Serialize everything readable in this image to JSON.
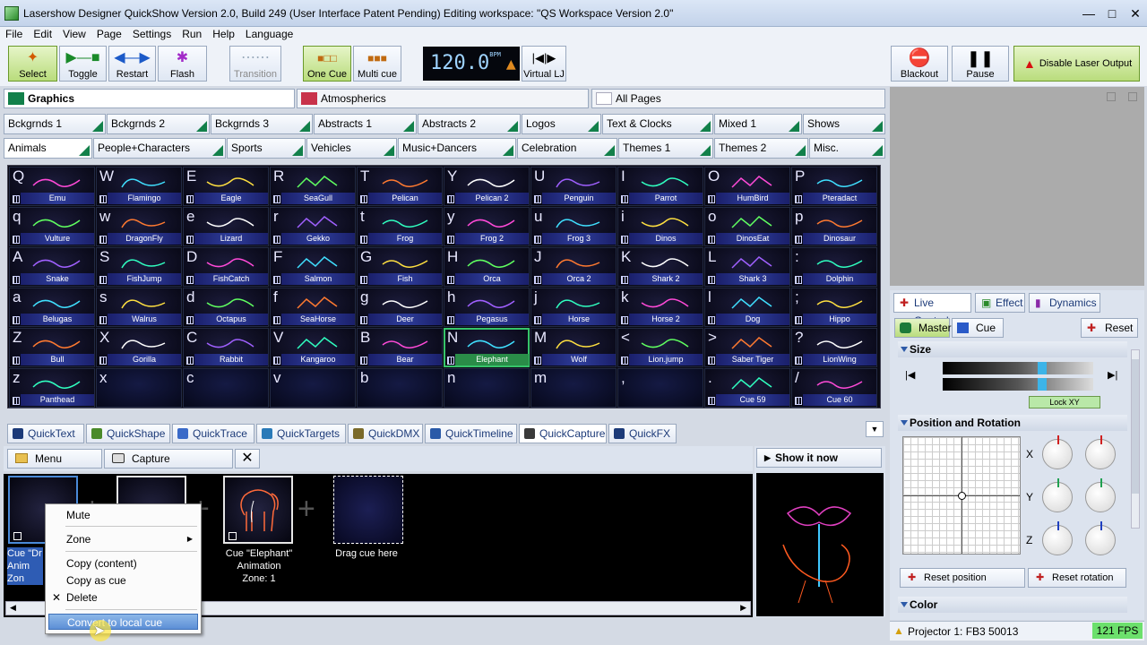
{
  "title": "Lasershow Designer QuickShow   Version 2.0, Build 249   (User Interface Patent Pending)   Editing workspace: \"QS Workspace Version 2.0\"",
  "menu": [
    "File",
    "Edit",
    "View",
    "Page",
    "Settings",
    "Run",
    "Help",
    "Language"
  ],
  "toolbar": {
    "select": "Select",
    "toggle": "Toggle",
    "restart": "Restart",
    "flash": "Flash",
    "transition": "Transition",
    "one_cue": "One Cue",
    "multi_cue": "Multi cue",
    "bpm": "120.0",
    "bpm_unit": "BPM",
    "virtual_lj": "Virtual LJ",
    "blackout": "Blackout",
    "pause": "Pause",
    "disable_laser": "Disable Laser Output"
  },
  "categories": {
    "graphics": "Graphics",
    "atmospherics": "Atmospherics",
    "all_pages": "All Pages"
  },
  "tabs_row1": [
    "Bckgrnds 1",
    "Bckgrnds 2",
    "Bckgrnds 3",
    "Abstracts 1",
    "Abstracts 2",
    "Logos",
    "Text & Clocks",
    "Mixed 1",
    "Shows"
  ],
  "tabs_row2": [
    "Animals",
    "People+Characters",
    "Sports",
    "Vehicles",
    "Music+Dancers",
    "Celebration",
    "Themes 1",
    "Themes 2",
    "Misc."
  ],
  "grid": [
    [
      [
        "Q",
        "Emu"
      ],
      [
        "W",
        "Flamingo"
      ],
      [
        "E",
        "Eagle"
      ],
      [
        "R",
        "SeaGull"
      ],
      [
        "T",
        "Pelican"
      ],
      [
        "Y",
        "Pelican 2"
      ],
      [
        "U",
        "Penguin"
      ],
      [
        "I",
        "Parrot"
      ],
      [
        "O",
        "HumBird"
      ],
      [
        "P",
        "Pteradact"
      ]
    ],
    [
      [
        "q",
        "Vulture"
      ],
      [
        "w",
        "DragonFly"
      ],
      [
        "e",
        "Lizard"
      ],
      [
        "r",
        "Gekko"
      ],
      [
        "t",
        "Frog"
      ],
      [
        "y",
        "Frog 2"
      ],
      [
        "u",
        "Frog 3"
      ],
      [
        "i",
        "Dinos"
      ],
      [
        "o",
        "DinosEat"
      ],
      [
        "p",
        "Dinosaur"
      ]
    ],
    [
      [
        "A",
        "Snake"
      ],
      [
        "S",
        "FishJump"
      ],
      [
        "D",
        "FishCatch"
      ],
      [
        "F",
        "Salmon"
      ],
      [
        "G",
        "Fish"
      ],
      [
        "H",
        "Orca"
      ],
      [
        "J",
        "Orca 2"
      ],
      [
        "K",
        "Shark 2"
      ],
      [
        "L",
        "Shark 3"
      ],
      [
        ":",
        "Dolphin"
      ]
    ],
    [
      [
        "a",
        "Belugas"
      ],
      [
        "s",
        "Walrus"
      ],
      [
        "d",
        "Octapus"
      ],
      [
        "f",
        "SeaHorse"
      ],
      [
        "g",
        "Deer"
      ],
      [
        "h",
        "Pegasus"
      ],
      [
        "j",
        "Horse"
      ],
      [
        "k",
        "Horse 2"
      ],
      [
        "l",
        "Dog"
      ],
      [
        ";",
        "Hippo"
      ]
    ],
    [
      [
        "Z",
        "Bull"
      ],
      [
        "X",
        "Gorilla"
      ],
      [
        "C",
        "Rabbit"
      ],
      [
        "V",
        "Kangaroo"
      ],
      [
        "B",
        "Bear"
      ],
      [
        "N",
        "Elephant"
      ],
      [
        "M",
        "Wolf"
      ],
      [
        "<",
        "Lion.jump"
      ],
      [
        ">",
        "Saber Tiger"
      ],
      [
        "?",
        "LionWing"
      ]
    ],
    [
      [
        "z",
        "Panthead"
      ],
      [
        "x",
        ""
      ],
      [
        "c",
        ""
      ],
      [
        "v",
        ""
      ],
      [
        "b",
        ""
      ],
      [
        "n",
        ""
      ],
      [
        "m",
        ""
      ],
      [
        ",",
        ""
      ],
      [
        ".",
        "Cue 59"
      ],
      [
        "/",
        "Cue 60"
      ]
    ]
  ],
  "bottom_tabs": [
    "QuickText",
    "QuickShape",
    "QuickTrace",
    "QuickTargets",
    "QuickDMX",
    "QuickTimeline",
    "QuickCapture",
    "QuickFX"
  ],
  "capture": {
    "menu": "Menu",
    "capture": "Capture",
    "show_it_now": "Show it now",
    "drag_here": "Drag cue here",
    "cue1": [
      "Cue \"Dr",
      "Anim",
      "Zon"
    ],
    "cue3": [
      "Cue \"Elephant\"",
      "Animation",
      "Zone: 1"
    ]
  },
  "context_menu": [
    "Mute",
    "Zone",
    "Copy (content)",
    "Copy as cue",
    "Delete",
    "Convert to local cue"
  ],
  "live": {
    "tab_live": "Live Control",
    "tab_effect": "Effect",
    "tab_dynamics": "Dynamics",
    "master": "Master",
    "cue": "Cue",
    "reset": "Reset",
    "size": "Size",
    "lock_xy": "Lock XY",
    "pos_rot": "Position and Rotation",
    "x": "X",
    "y": "Y",
    "z": "Z",
    "reset_position": "Reset position",
    "reset_rotation": "Reset rotation",
    "color": "Color"
  },
  "status": {
    "projector": "Projector 1: FB3 50013",
    "fps": "121 FPS"
  },
  "colors": {
    "graphics_swatch": "#12804a",
    "atmospherics_swatch": "#c8324a",
    "selected_cell": "#36c46a"
  }
}
